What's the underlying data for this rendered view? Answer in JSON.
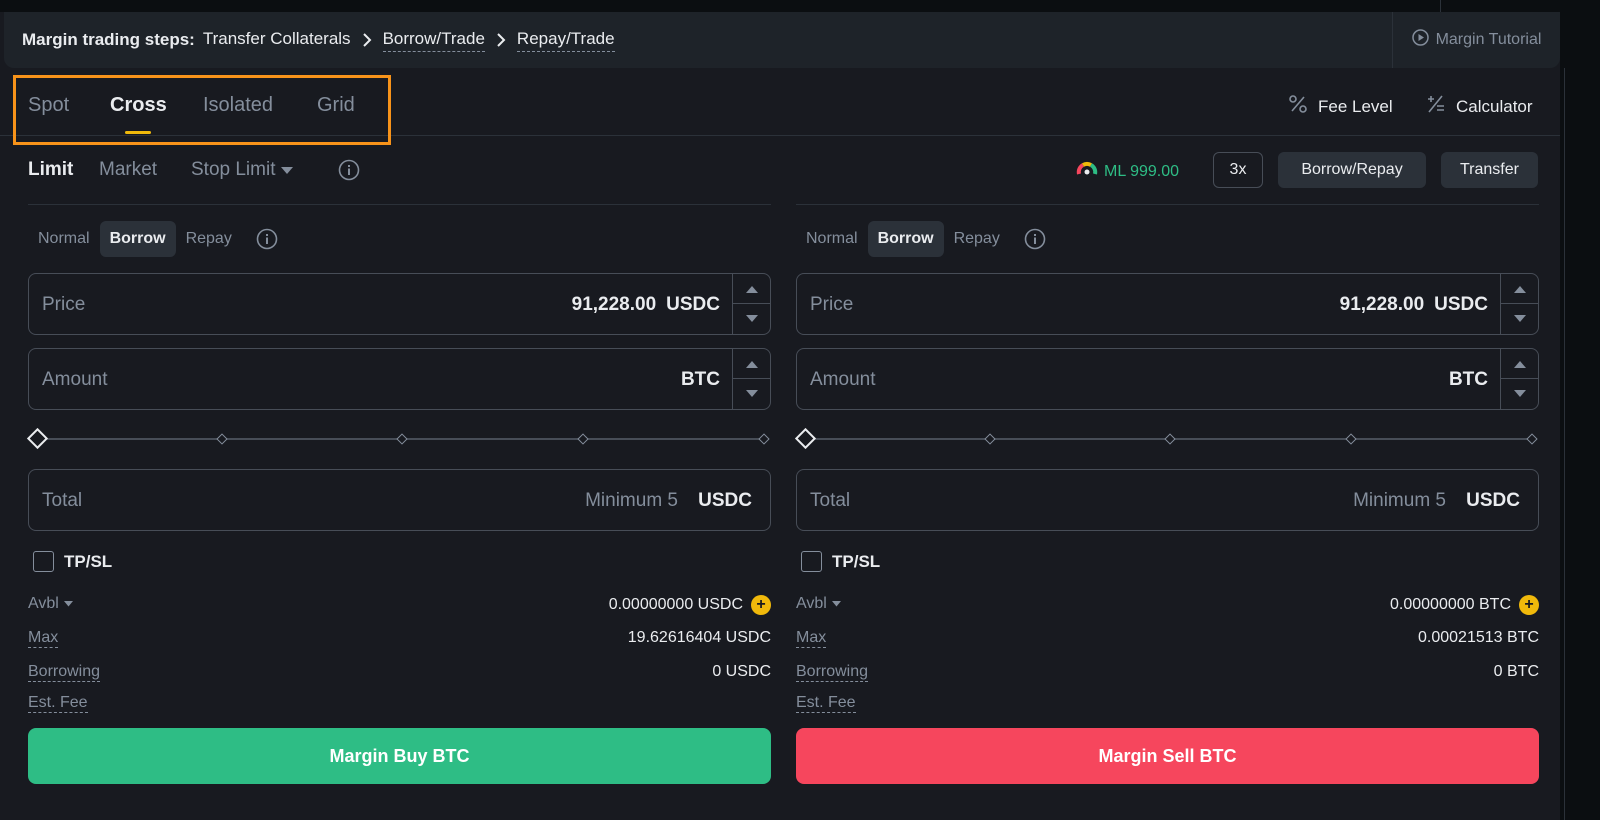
{
  "steps": {
    "label": "Margin trading steps:",
    "items": [
      "Transfer Collaterals",
      "Borrow/Trade",
      "Repay/Trade"
    ],
    "tutorial": "Margin Tutorial"
  },
  "tabs": [
    "Spot",
    "Cross",
    "Isolated",
    "Grid"
  ],
  "active_tab": "Cross",
  "tools": {
    "fee_level": "Fee Level",
    "calculator": "Calculator"
  },
  "order_types": {
    "limit": "Limit",
    "market": "Market",
    "stop_limit": "Stop Limit"
  },
  "account": {
    "ml": "ML 999.00",
    "leverage": "3x",
    "borrow_repay": "Borrow/Repay",
    "transfer": "Transfer"
  },
  "modes": [
    "Normal",
    "Borrow",
    "Repay"
  ],
  "active_mode": "Borrow",
  "buy": {
    "price_label": "Price",
    "price_value": "91,228.00",
    "price_unit": "USDC",
    "amount_label": "Amount",
    "amount_unit": "BTC",
    "total_label": "Total",
    "total_hint": "Minimum 5",
    "total_unit": "USDC",
    "tpsl": "TP/SL",
    "avbl_label": "Avbl",
    "avbl_value": "0.00000000 USDC",
    "max_label": "Max",
    "max_value": "19.62616404 USDC",
    "borrowing_label": "Borrowing",
    "borrowing_value": "0 USDC",
    "fee_label": "Est. Fee",
    "action": "Margin Buy BTC"
  },
  "sell": {
    "price_label": "Price",
    "price_value": "91,228.00",
    "price_unit": "USDC",
    "amount_label": "Amount",
    "amount_unit": "BTC",
    "total_label": "Total",
    "total_hint": "Minimum 5",
    "total_unit": "USDC",
    "tpsl": "TP/SL",
    "avbl_label": "Avbl",
    "avbl_value": "0.00000000 BTC",
    "max_label": "Max",
    "max_value": "0.00021513 BTC",
    "borrowing_label": "Borrowing",
    "borrowing_value": "0 BTC",
    "fee_label": "Est. Fee",
    "action": "Margin Sell BTC"
  },
  "colors": {
    "buy": "#2ebd85",
    "sell": "#f6465d",
    "accent": "#f0b90b",
    "highlight_box": "#f7931a"
  }
}
